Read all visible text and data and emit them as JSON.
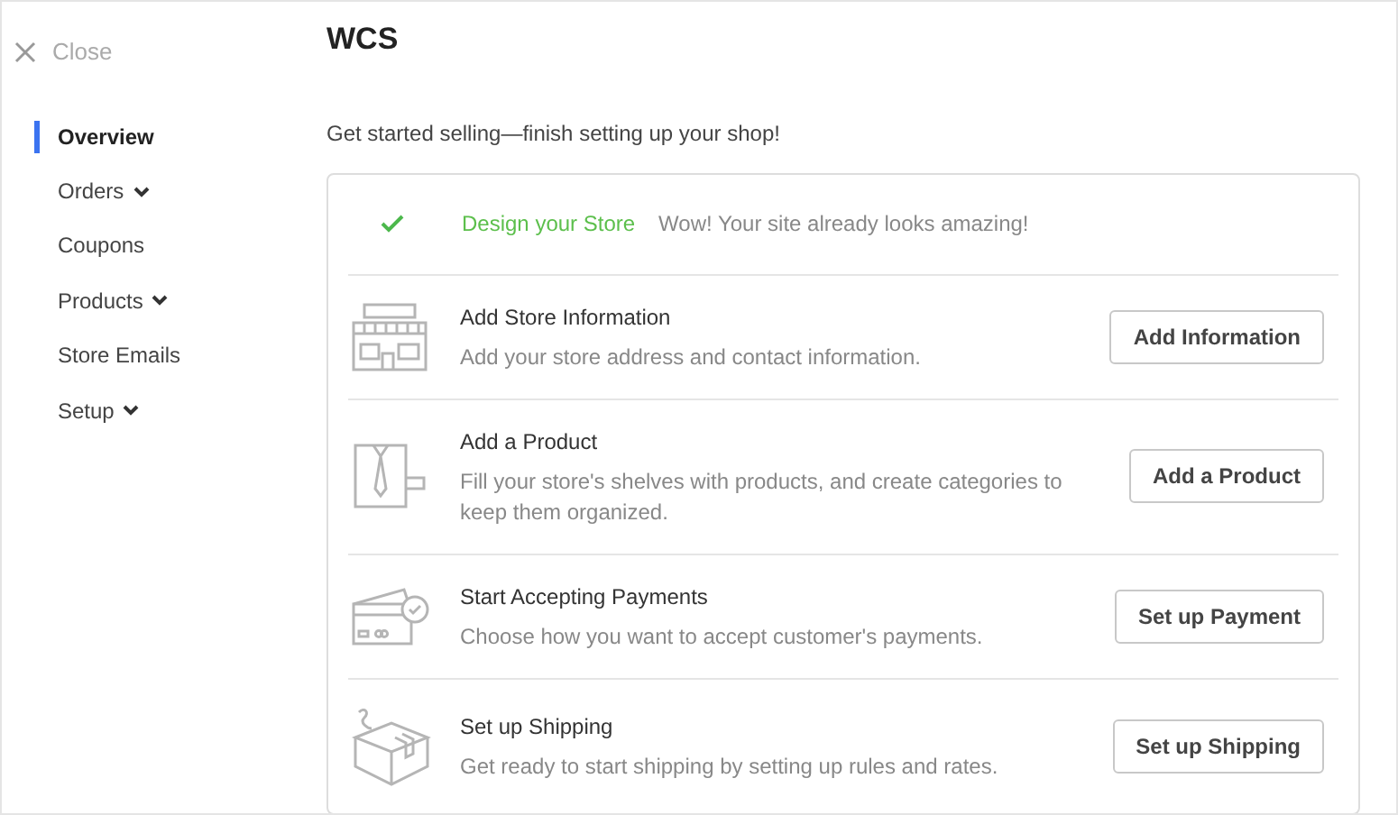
{
  "close": {
    "label": "Close"
  },
  "nav": [
    {
      "label": "Overview",
      "selected": true,
      "expandable": false
    },
    {
      "label": "Orders",
      "selected": false,
      "expandable": true
    },
    {
      "label": "Coupons",
      "selected": false,
      "expandable": false
    },
    {
      "label": "Products",
      "selected": false,
      "expandable": true
    },
    {
      "label": "Store Emails",
      "selected": false,
      "expandable": false
    },
    {
      "label": "Setup",
      "selected": false,
      "expandable": true
    }
  ],
  "title": "WCS",
  "subtitle": "Get started selling—finish setting up your shop!",
  "tasks": [
    {
      "kind": "done",
      "title": "Design your Store",
      "description": "Wow! Your site already looks amazing!"
    },
    {
      "kind": "todo",
      "title": "Add Store Information",
      "description": "Add your store address and contact information.",
      "button": "Add Information"
    },
    {
      "kind": "todo",
      "title": "Add a Product",
      "description": "Fill your store's shelves with products, and create categories to keep them organized.",
      "button": "Add a Product"
    },
    {
      "kind": "todo",
      "title": "Start Accepting Payments",
      "description": "Choose how you want to accept customer's payments.",
      "button": "Set up Payment"
    },
    {
      "kind": "todo",
      "title": "Set up Shipping",
      "description": "Get ready to start shipping by setting up rules and rates.",
      "button": "Set up Shipping"
    }
  ]
}
